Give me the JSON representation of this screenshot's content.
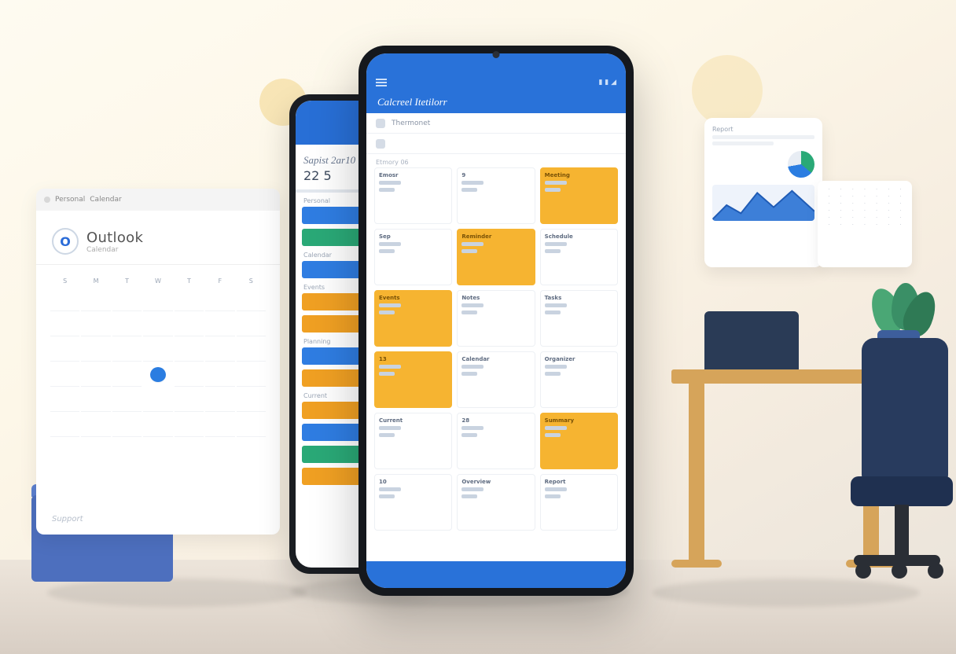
{
  "monitor": {
    "tab1": "Personal",
    "tab2": "Calendar",
    "brand": "Outlook",
    "brand_sub": "Calendar",
    "logo_letter": "O",
    "weekdays": [
      "S",
      "M",
      "T",
      "W",
      "T",
      "F",
      "S"
    ],
    "footer": "Support"
  },
  "phone_back": {
    "title": "Sapist 2ar10",
    "date": "22 5",
    "labels": [
      "Personal",
      "Calendar",
      "Events",
      "Planning",
      "Current"
    ]
  },
  "phone_front": {
    "header": "Calcreel Itetilorr",
    "row1": "Thermonet",
    "section": "Etmory 06",
    "cards": [
      {
        "t": "Emosr"
      },
      {
        "t": "9"
      },
      {
        "t": "Meeting",
        "hl": true
      },
      {
        "t": "Sep"
      },
      {
        "t": "Reminder",
        "hl": true
      },
      {
        "t": "Schedule"
      },
      {
        "t": "Events",
        "hl": true
      },
      {
        "t": "Notes"
      },
      {
        "t": "Tasks"
      },
      {
        "t": "13",
        "hl": true
      },
      {
        "t": "Calendar"
      },
      {
        "t": "Organizer"
      },
      {
        "t": "Current"
      },
      {
        "t": "28"
      },
      {
        "t": "Summary",
        "hl": true
      },
      {
        "t": "10"
      },
      {
        "t": "Overview"
      },
      {
        "t": "Report"
      }
    ]
  },
  "report": {
    "title": "Report"
  }
}
